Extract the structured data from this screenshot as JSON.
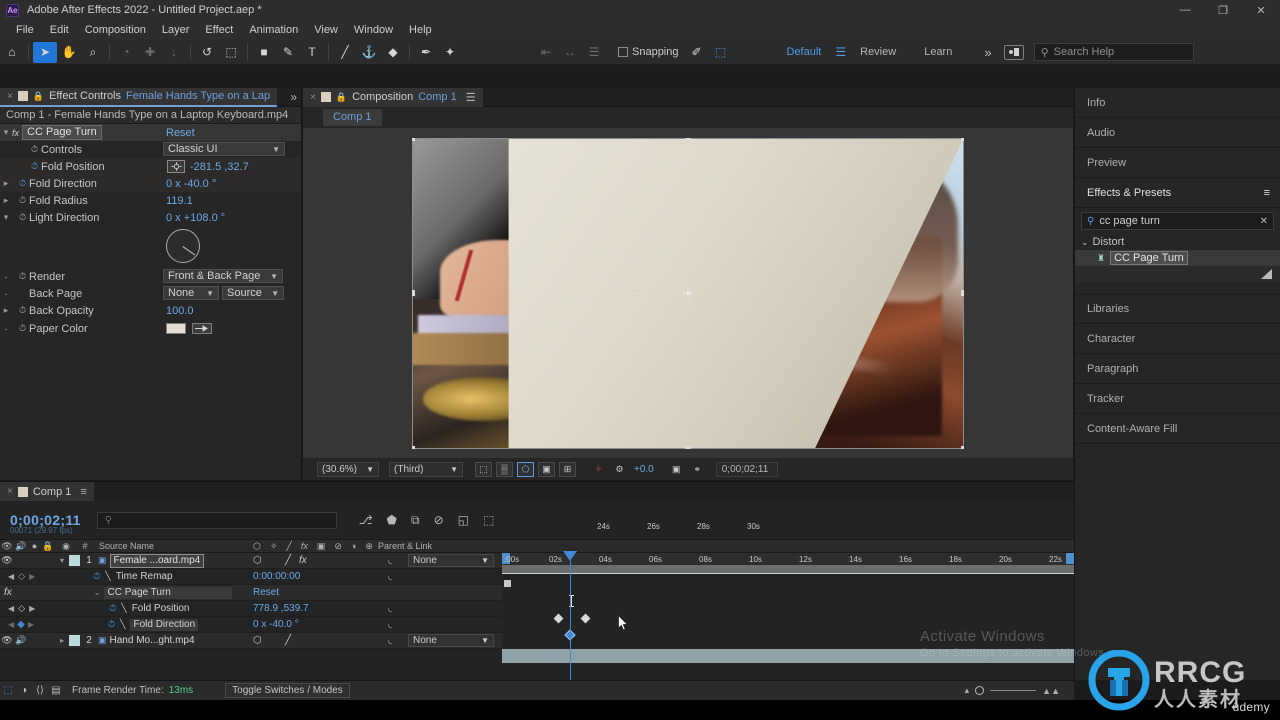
{
  "window": {
    "app_icon_label": "Ae",
    "title": "Adobe After Effects 2022 - Untitled Project.aep *",
    "minimize": "—",
    "maximize": "❐",
    "close": "✕"
  },
  "menubar": {
    "items": [
      "File",
      "Edit",
      "Composition",
      "Layer",
      "Effect",
      "Animation",
      "View",
      "Window",
      "Help"
    ]
  },
  "toolbar": {
    "tools": [
      {
        "name": "home-icon",
        "glyph": "⌂",
        "state": "normal"
      },
      {
        "name": "selection-tool-icon",
        "glyph": "➤",
        "state": "selected"
      },
      {
        "name": "hand-tool-icon",
        "glyph": "✋",
        "state": "normal"
      },
      {
        "name": "zoom-tool-icon",
        "glyph": "⌕",
        "state": "normal"
      },
      {
        "name": "orbit-tool-icon",
        "glyph": "◔",
        "state": "dim"
      },
      {
        "name": "pan-under-tool-icon",
        "glyph": "✚",
        "state": "dim"
      },
      {
        "name": "dolly-tool-icon",
        "glyph": "↓",
        "state": "dim"
      },
      {
        "name": "rotation-tool-icon",
        "glyph": "↺",
        "state": "normal"
      },
      {
        "name": "roto-brush-tool-icon",
        "glyph": "⬚",
        "state": "normal"
      },
      {
        "name": "shape-tool-icon",
        "glyph": "■",
        "state": "normal"
      },
      {
        "name": "pen-tool-icon",
        "glyph": "✎",
        "state": "normal"
      },
      {
        "name": "type-tool-icon",
        "glyph": "T",
        "state": "normal"
      },
      {
        "name": "brush-tool-icon",
        "glyph": "╱",
        "state": "normal"
      },
      {
        "name": "clone-stamp-tool-icon",
        "glyph": "⚓",
        "state": "normal"
      },
      {
        "name": "eraser-tool-icon",
        "glyph": "◆",
        "state": "normal"
      },
      {
        "name": "puppet-pin-tool-icon",
        "glyph": "✒",
        "state": "normal"
      },
      {
        "name": "puppet-starch-tool-icon",
        "glyph": "✦",
        "state": "normal"
      }
    ],
    "align_tools": [
      {
        "name": "align-left-icon",
        "glyph": "⇤"
      },
      {
        "name": "align-center-icon",
        "glyph": "↔"
      },
      {
        "name": "align-distribute-icon",
        "glyph": "☰"
      }
    ],
    "snapping_label": "Snapping",
    "snapping_checked": false,
    "snap_extra": [
      {
        "name": "snap-vertex-icon",
        "glyph": "✐"
      },
      {
        "name": "snap-area-icon",
        "glyph": "⬚"
      }
    ],
    "workspaces": [
      {
        "label": "Default",
        "active": true
      },
      {
        "label": "Review",
        "active": false
      },
      {
        "label": "Learn",
        "active": false
      }
    ],
    "workspace_overflow": "»",
    "search_help_placeholder": "Search Help"
  },
  "effect_controls": {
    "tab_title": "Effect Controls",
    "tab_subject": "Female Hands Type on a Lap",
    "subtitle": "Comp 1 - Female Hands Type on a Laptop Keyboard.mp4",
    "effect_name": "CC Page Turn",
    "reset_label": "Reset",
    "properties": [
      {
        "label": "Controls",
        "type": "dropdown",
        "value": "Classic UI",
        "stopwatch": "off",
        "twirl": false
      },
      {
        "label": "Fold Position",
        "type": "point",
        "value": "-281.5 ,32.7",
        "stopwatch": "on",
        "twirl": false
      },
      {
        "label": "Fold Direction",
        "type": "angle",
        "value": "0 x -40.0 °",
        "stopwatch": "on",
        "twirl": true
      },
      {
        "label": "Fold Radius",
        "type": "number",
        "value": "119.1",
        "stopwatch": "off",
        "twirl": true
      },
      {
        "label": "Light Direction",
        "type": "angle-dial",
        "value": "0 x +108.0 °",
        "stopwatch": "off",
        "twirl": true
      },
      {
        "label": "Render",
        "type": "dropdown",
        "value": "Front & Back Page",
        "stopwatch": "off",
        "twirl": false
      },
      {
        "label": "Back Page",
        "type": "dual-dropdown",
        "value": "None",
        "value2": "Source",
        "stopwatch": "none",
        "twirl": false
      },
      {
        "label": "Back Opacity",
        "type": "number",
        "value": "100.0",
        "stopwatch": "off",
        "twirl": true
      },
      {
        "label": "Paper Color",
        "type": "color",
        "value": "#e4ddd0",
        "stopwatch": "off",
        "twirl": false
      }
    ]
  },
  "composition": {
    "tab_title": "Composition",
    "tab_subject": "Comp 1",
    "inner_tab": "Comp 1",
    "viewer_bar": {
      "zoom": "(30.6%)",
      "resolution": "(Third)",
      "buttons": [
        {
          "name": "region-of-interest-icon",
          "glyph": "⬚"
        },
        {
          "name": "transparency-grid-icon",
          "glyph": "▒"
        },
        {
          "name": "toggle-mask-icon",
          "glyph": "⬠",
          "active": true
        },
        {
          "name": "toggle-view-layout-icon",
          "glyph": "▣"
        },
        {
          "name": "pixel-aspect-correction-icon",
          "glyph": "⊞"
        },
        {
          "name": "fast-previews-icon",
          "glyph": "✧"
        },
        {
          "name": "timeline-settings-icon",
          "glyph": "⚙"
        }
      ],
      "exposure": "+0.0",
      "snapshot_icon": "▣",
      "show_snapshot_icon": "⚭",
      "time": "0;00;02;11"
    }
  },
  "right_dock": {
    "panels": [
      {
        "label": "Info",
        "type": "collapsed"
      },
      {
        "label": "Audio",
        "type": "collapsed"
      },
      {
        "label": "Preview",
        "type": "collapsed"
      },
      {
        "label": "Effects & Presets",
        "type": "open"
      },
      {
        "label": "Libraries",
        "type": "collapsed"
      },
      {
        "label": "Character",
        "type": "collapsed"
      },
      {
        "label": "Paragraph",
        "type": "collapsed"
      },
      {
        "label": "Tracker",
        "type": "collapsed"
      },
      {
        "label": "Content-Aware Fill",
        "type": "collapsed"
      }
    ],
    "effects_presets": {
      "search_value": "cc page turn",
      "clear_icon": "✕",
      "menu_icon": "≡",
      "category": "Distort",
      "category_twirl": "⌄",
      "result": "CC Page Turn",
      "result_icon": "♜"
    }
  },
  "timeline": {
    "tab_title": "Comp 1",
    "menu_icon": "≡",
    "current_time": "0;00;02;11",
    "current_frame": "00071 (29.97 fps)",
    "search_placeholder": "",
    "header_icons": [
      {
        "name": "composition-mini-flowchart-icon",
        "glyph": "⎇"
      },
      {
        "name": "draft-3d-icon",
        "glyph": "⬟"
      },
      {
        "name": "hide-shy-layers-icon",
        "glyph": "⧉"
      },
      {
        "name": "frame-blending-icon",
        "glyph": "⊘"
      },
      {
        "name": "motion-blur-icon",
        "glyph": "◱"
      },
      {
        "name": "graph-editor-icon",
        "glyph": "⬚"
      }
    ],
    "columns": {
      "source_name": "Source Name",
      "parent_link": "Parent & Link",
      "switch_icons": [
        "⬡",
        "✧",
        "╱",
        "fx",
        "▣",
        "⊘",
        "◑",
        "⊕"
      ]
    },
    "rows": [
      {
        "kind": "layer",
        "index": "1",
        "name": "Female ...oard.mp4",
        "eye": true,
        "audio": false,
        "parent": "None",
        "selected": true,
        "switches": [
          "⬡",
          "╱",
          "fx"
        ]
      },
      {
        "kind": "property",
        "name": "Time Remap",
        "value": "0:00:00:00",
        "stopwatch": "on",
        "graph": true
      },
      {
        "kind": "effect",
        "name": "CC Page Turn",
        "value": "Reset",
        "twirl": "⌄",
        "fx_badge": "fx"
      },
      {
        "kind": "property",
        "name": "Fold Position",
        "value": "778.9 ,539.7",
        "stopwatch": "on",
        "graph": true,
        "keyframe_nav": true
      },
      {
        "kind": "property",
        "name": "Fold Direction",
        "value": "0 x -40.0 °",
        "stopwatch": "on",
        "graph": true,
        "keyframe_nav": true,
        "at_keyframe": true
      },
      {
        "kind": "layer",
        "index": "2",
        "name": "Hand Mo...ght.mp4",
        "eye": true,
        "audio": true,
        "parent": "None",
        "selected": false,
        "switches": [
          "⬡",
          "╱"
        ]
      }
    ],
    "ruler_ticks": [
      ":00s",
      "02s",
      "04s",
      "06s",
      "08s",
      "10s",
      "12s",
      "14s",
      "16s",
      "18s",
      "20s",
      "22s",
      "24s",
      "26s",
      "28s",
      "30s"
    ],
    "keyframes_fold_position": [
      1.2,
      2.6
    ],
    "keyframe_fold_direction": [
      2.4
    ]
  },
  "status_bar": {
    "icons": [
      {
        "name": "render-queue-icon",
        "glyph": "⬚",
        "accent": true
      },
      {
        "name": "layer-switch-icon",
        "glyph": "◑"
      },
      {
        "name": "expression-icon",
        "glyph": "⟨⟩"
      },
      {
        "name": "comp-flowchart-icon",
        "glyph": "▤"
      }
    ],
    "frame_render_label": "Frame Render Time:",
    "frame_render_value": "13ms",
    "toggle_switches_label": "Toggle Switches / Modes",
    "zoom_out_icon": "▴",
    "zoom_in_icon": "▲▲"
  },
  "watermark": {
    "activate_line1": "Activate Windows",
    "activate_line2": "Go to Settings to activate Windows.",
    "brand_latin": "RRCG",
    "brand_cjk": "人人素材",
    "udemy": "ûdemy"
  },
  "colors": {
    "accent_blue": "#6ea8e4",
    "panel_bg": "#262626",
    "title_bg": "#2d2d2d",
    "selection_blue": "#2176d6",
    "paper_color": "#e4ddd0",
    "track_green": "#2e8b3d"
  }
}
